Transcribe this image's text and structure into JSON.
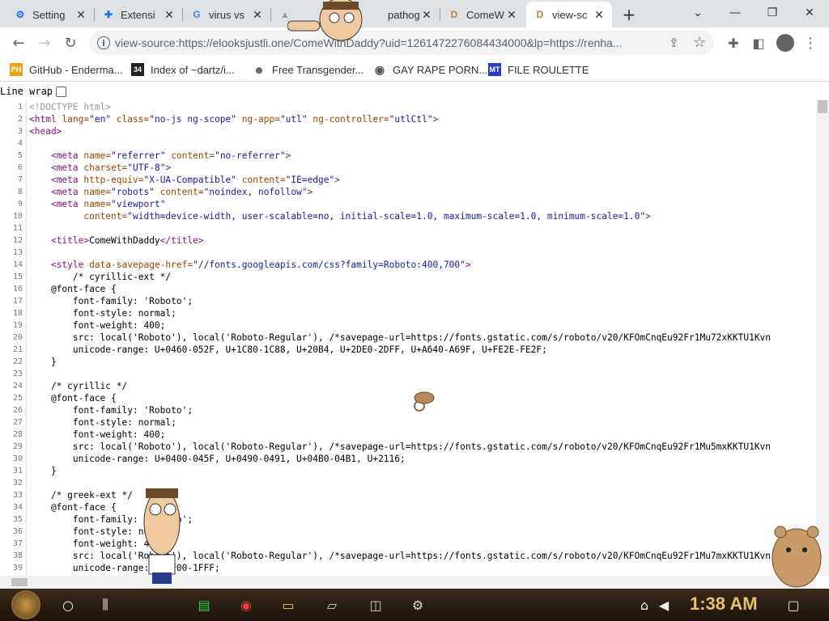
{
  "tabs": [
    {
      "label": "Setting",
      "icon": "gear-icon",
      "icon_color": "#1a73e8"
    },
    {
      "label": "Extensi",
      "icon": "puzzle-icon",
      "icon_color": "#1a73e8"
    },
    {
      "label": "virus vs",
      "icon": "google-icon",
      "icon_color": "#4285f4"
    },
    {
      "label": "pathoge",
      "icon": "page-icon",
      "icon_color": "#999"
    },
    {
      "label": "ComeW",
      "icon": "d-icon",
      "icon_color": "#c97d3b"
    },
    {
      "label": "view-sc",
      "icon": "d-icon",
      "icon_color": "#c97d3b"
    }
  ],
  "address_bar": {
    "url": "view-source:https://elooksjustli.one/ComeWithDaddy?uid=1261472276084434000&lp=https://renha..."
  },
  "bookmarks": [
    {
      "label": "GitHub - Enderma...",
      "icon": "ph-icon",
      "icon_text": "PH",
      "icon_color": "#e8a317"
    },
    {
      "label": "Index of ~dartz/i...",
      "icon": "image-icon",
      "icon_text": "34",
      "icon_color": "#222"
    },
    {
      "label": "Free Transgender...",
      "icon": "mask-icon",
      "icon_text": "",
      "icon_color": "#555"
    },
    {
      "label": "GAY RAPE PORN...",
      "icon": "globe-icon",
      "icon_text": "",
      "icon_color": "#555"
    },
    {
      "label": "FILE ROULETTE",
      "icon": "mt-icon",
      "icon_text": "MT",
      "icon_color": "#2a3dbf"
    }
  ],
  "line_wrap_label": "Line wrap",
  "source_lines": [
    {
      "n": "1",
      "html": "<span class=\"c-d\">&lt;!DOCTYPE html&gt;</span>"
    },
    {
      "n": "2",
      "html": "<span class=\"c-t\">&lt;html</span> <span class=\"c-a\">lang=</span><span class=\"c-v\">\"en\"</span> <span class=\"c-a\">class=</span><span class=\"c-v\">\"no-js ng-scope\"</span> <span class=\"c-a\">ng-app=</span><span class=\"c-v\">\"utl\"</span> <span class=\"c-a\">ng-controller=</span><span class=\"c-v\">\"utlCtl\"</span><span class=\"c-t\">&gt;</span>"
    },
    {
      "n": "3",
      "html": "<span class=\"c-t\">&lt;head&gt;</span>"
    },
    {
      "n": "4",
      "html": ""
    },
    {
      "n": "5",
      "html": "    <span class=\"c-t\">&lt;meta</span> <span class=\"c-a\">name=</span><span class=\"c-v\">\"referrer\"</span> <span class=\"c-a\">content=</span><span class=\"c-v\">\"no-referrer\"</span><span class=\"c-t\">&gt;</span>"
    },
    {
      "n": "6",
      "html": "    <span class=\"c-t\">&lt;meta</span> <span class=\"c-a\">charset=</span><span class=\"c-v\">\"UTF-8\"</span><span class=\"c-t\">&gt;</span>"
    },
    {
      "n": "7",
      "html": "    <span class=\"c-t\">&lt;meta</span> <span class=\"c-a\">http-equiv=</span><span class=\"c-v\">\"X-UA-Compatible\"</span> <span class=\"c-a\">content=</span><span class=\"c-v\">\"IE=edge\"</span><span class=\"c-t\">&gt;</span>"
    },
    {
      "n": "8",
      "html": "    <span class=\"c-t\">&lt;meta</span> <span class=\"c-a\">name=</span><span class=\"c-v\">\"robots\"</span> <span class=\"c-a\">content=</span><span class=\"c-v\">\"noindex, nofollow\"</span><span class=\"c-t\">&gt;</span>"
    },
    {
      "n": "9",
      "html": "    <span class=\"c-t\">&lt;meta</span> <span class=\"c-a\">name=</span><span class=\"c-v\">\"viewport\"</span>"
    },
    {
      "n": "10",
      "html": "          <span class=\"c-a\">content=</span><span class=\"c-v\">\"width=device-width, user-scalable=no, initial-scale=1.0, maximum-scale=1.0, minimum-scale=1.0\"</span><span class=\"c-t\">&gt;</span>"
    },
    {
      "n": "11",
      "html": ""
    },
    {
      "n": "12",
      "html": "    <span class=\"c-t\">&lt;title&gt;</span>ComeWithDaddy<span class=\"c-t\">&lt;/title&gt;</span>"
    },
    {
      "n": "13",
      "html": ""
    },
    {
      "n": "14",
      "html": "    <span class=\"c-t\">&lt;style</span> <span class=\"c-a\">data-savepage-href=</span><span class=\"c-v\">\"//fonts.googleapis.com/css?family=Roboto:400,700\"</span><span class=\"c-t\">&gt;</span>"
    },
    {
      "n": "15",
      "html": "        /* cyrillic-ext */"
    },
    {
      "n": "16",
      "html": "    @font-face {"
    },
    {
      "n": "17",
      "html": "        font-family: 'Roboto';"
    },
    {
      "n": "18",
      "html": "        font-style: normal;"
    },
    {
      "n": "19",
      "html": "        font-weight: 400;"
    },
    {
      "n": "20",
      "html": "        src: local('Roboto'), local('Roboto-Regular'), /*savepage-url=https://fonts.gstatic.com/s/roboto/v20/KFOmCnqEu92Fr1Mu72xKKTU1Kvn"
    },
    {
      "n": "21",
      "html": "        unicode-range: U+0460-052F, U+1C80-1C88, U+20B4, U+2DE0-2DFF, U+A640-A69F, U+FE2E-FE2F;"
    },
    {
      "n": "22",
      "html": "    }"
    },
    {
      "n": "23",
      "html": ""
    },
    {
      "n": "24",
      "html": "    /* cyrillic */"
    },
    {
      "n": "25",
      "html": "    @font-face {"
    },
    {
      "n": "26",
      "html": "        font-family: 'Roboto';"
    },
    {
      "n": "27",
      "html": "        font-style: normal;"
    },
    {
      "n": "28",
      "html": "        font-weight: 400;"
    },
    {
      "n": "29",
      "html": "        src: local('Roboto'), local('Roboto-Regular'), /*savepage-url=https://fonts.gstatic.com/s/roboto/v20/KFOmCnqEu92Fr1Mu5mxKKTU1Kvn"
    },
    {
      "n": "30",
      "html": "        unicode-range: U+0400-045F, U+0490-0491, U+04B0-04B1, U+2116;"
    },
    {
      "n": "31",
      "html": "    }"
    },
    {
      "n": "32",
      "html": ""
    },
    {
      "n": "33",
      "html": "    /* greek-ext */"
    },
    {
      "n": "34",
      "html": "    @font-face {"
    },
    {
      "n": "35",
      "html": "        font-family: 'Roboto';"
    },
    {
      "n": "36",
      "html": "        font-style: normal;"
    },
    {
      "n": "37",
      "html": "        font-weight: 400;"
    },
    {
      "n": "38",
      "html": "        src: local('Roboto'), local('Roboto-Regular'), /*savepage-url=https://fonts.gstatic.com/s/roboto/v20/KFOmCnqEu92Fr1Mu7mxKKTU1Kvn"
    },
    {
      "n": "39",
      "html": "        unicode-range: U+1F00-1FFF;"
    }
  ],
  "taskbar": {
    "time": "1:38 AM",
    "time_color": "#e8c070"
  }
}
